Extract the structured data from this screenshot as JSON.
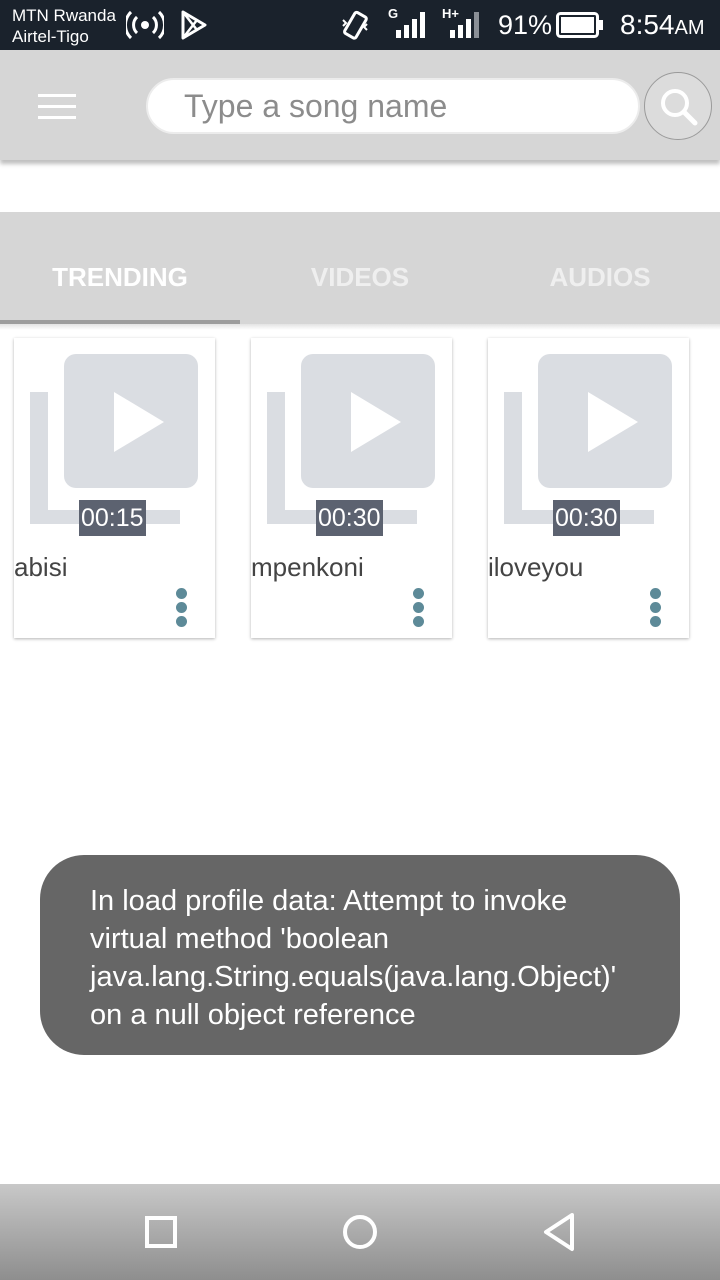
{
  "status_bar": {
    "carrier_1": "MTN Rwanda",
    "carrier_2": "Airtel-Tigo",
    "network_1": "G",
    "network_2": "H+",
    "battery_percent": "91%",
    "time": "8:54",
    "time_suffix": "AM",
    "icons": [
      "hotspot-icon",
      "play-store-icon",
      "vibrate-icon",
      "signal-icon",
      "signal-icon",
      "battery-icon"
    ]
  },
  "app_bar": {
    "menu_icon": "hamburger-icon",
    "search_placeholder": "Type a song name",
    "search_value": "",
    "search_icon": "search-icon"
  },
  "tabs": [
    {
      "label": "TRENDING",
      "active": true
    },
    {
      "label": "VIDEOS",
      "active": false
    },
    {
      "label": "AUDIOS",
      "active": false
    }
  ],
  "songs": [
    {
      "title": "abisi",
      "duration": "00:15"
    },
    {
      "title": "mpenkoni",
      "duration": "00:30"
    },
    {
      "title": "iloveyou",
      "duration": "00:30"
    }
  ],
  "toast": {
    "line_1": "In load profile data: Attempt to invoke",
    "line_2": "virtual method 'boolean",
    "line_3": "java.lang.String.equals(java.lang.Object)'",
    "line_4": "on a null object reference"
  },
  "nav_bar": {
    "icons": [
      "recents-icon",
      "home-icon",
      "back-icon"
    ]
  },
  "colors": {
    "status_bar": "#1a222c",
    "app_bar": "#d6d6d6",
    "duration_badge": "#5c6270",
    "more_dots": "#5d8a98",
    "toast": "#666666"
  }
}
